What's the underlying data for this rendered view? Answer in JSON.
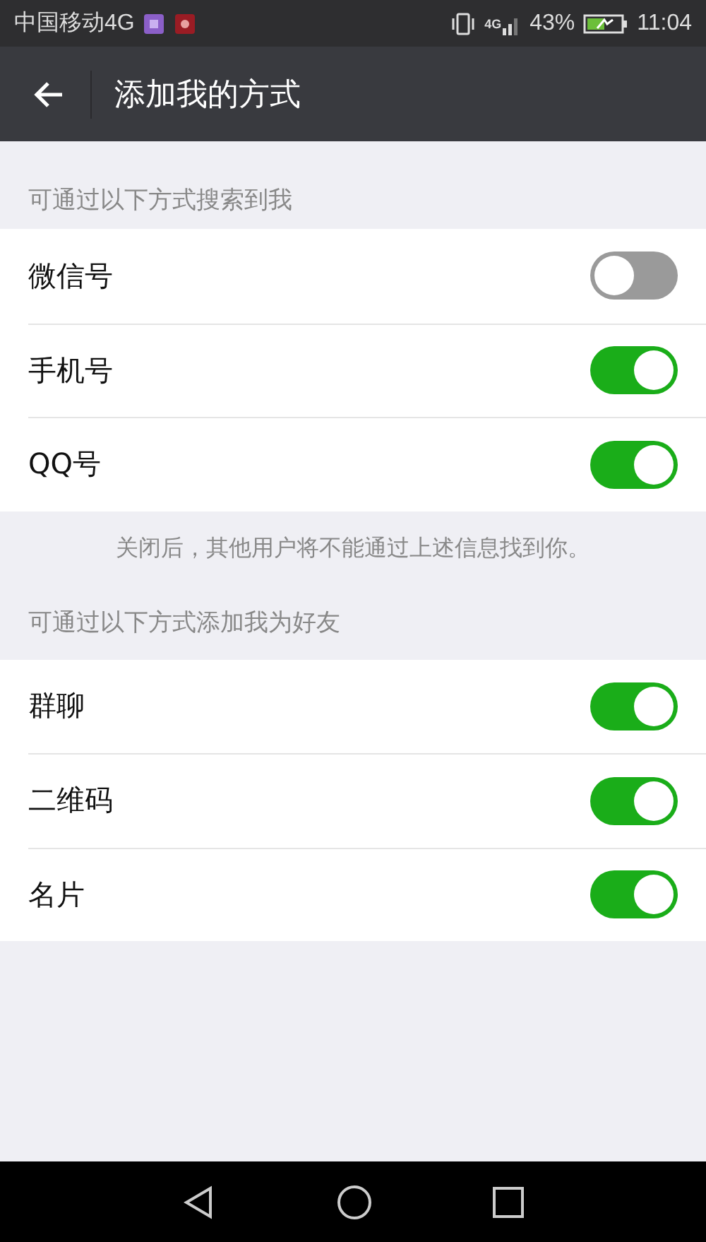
{
  "status_bar": {
    "carrier": "中国移动4G",
    "network": "4G",
    "battery": "43%",
    "time": "11:04"
  },
  "header": {
    "title": "添加我的方式"
  },
  "sections": [
    {
      "label": "可通过以下方式搜索到我",
      "items": [
        {
          "label": "微信号",
          "on": false
        },
        {
          "label": "手机号",
          "on": true
        },
        {
          "label": "QQ号",
          "on": true
        }
      ],
      "note": "关闭后，其他用户将不能通过上述信息找到你。"
    },
    {
      "label": "可通过以下方式添加我为好友",
      "items": [
        {
          "label": "群聊",
          "on": true
        },
        {
          "label": "二维码",
          "on": true
        },
        {
          "label": "名片",
          "on": true
        }
      ]
    }
  ]
}
